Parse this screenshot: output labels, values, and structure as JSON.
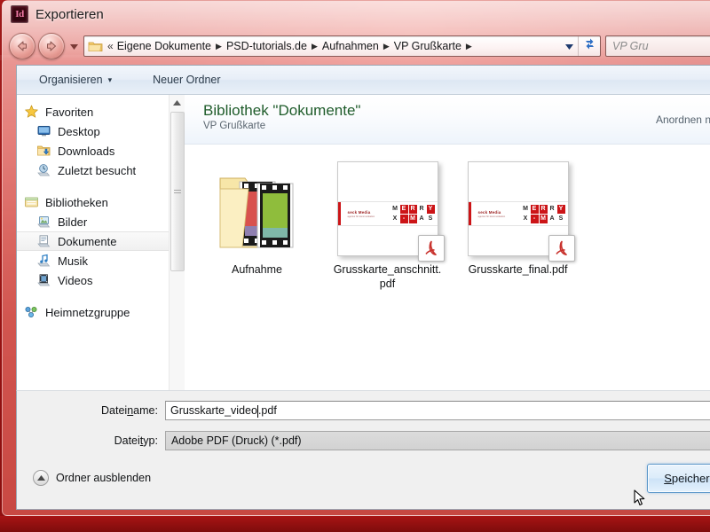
{
  "window": {
    "title": "Exportieren",
    "app_icon": "indesign-id-icon",
    "id_glyph": "Id"
  },
  "navigation": {
    "back_icon": "back-arrow-icon",
    "forward_icon": "forward-arrow-icon",
    "dropdown_icon": "chevron-down-icon",
    "refresh_icon": "refresh-icon",
    "folder_icon": "folder-icon"
  },
  "address_bar": {
    "overflow_marker": "«",
    "crumbs": [
      "Eigene Dokumente",
      "PSD-tutorials.de",
      "Aufnahmen",
      "VP Grußkarte"
    ],
    "separator": "▶"
  },
  "search": {
    "placeholder": "VP Gru",
    "icon": "search-icon"
  },
  "command_bar": {
    "organize_label": "Organisieren",
    "organize_caret": "▾",
    "new_folder_label": "Neuer Ordner"
  },
  "sidebar": {
    "groups": [
      {
        "header": {
          "label": "Favoriten",
          "icon": "star-icon"
        },
        "items": [
          {
            "label": "Desktop",
            "icon": "desktop-icon",
            "selected": false
          },
          {
            "label": "Downloads",
            "icon": "downloads-folder-icon",
            "selected": false
          },
          {
            "label": "Zuletzt besucht",
            "icon": "recent-places-icon",
            "selected": false
          }
        ]
      },
      {
        "header": {
          "label": "Bibliotheken",
          "icon": "libraries-icon"
        },
        "items": [
          {
            "label": "Bilder",
            "icon": "pictures-library-icon",
            "selected": false
          },
          {
            "label": "Dokumente",
            "icon": "documents-library-icon",
            "selected": true
          },
          {
            "label": "Musik",
            "icon": "music-library-icon",
            "selected": false
          },
          {
            "label": "Videos",
            "icon": "videos-library-icon",
            "selected": false
          }
        ]
      },
      {
        "header": {
          "label": "Heimnetzgruppe",
          "icon": "homegroup-icon"
        },
        "items": []
      }
    ],
    "scrollbar": {
      "up_arrow": "scroll-up-arrow",
      "down_arrow": "scroll-down-arrow"
    }
  },
  "content_header": {
    "title": "Bibliothek \"Dokumente\"",
    "subtitle": "VP Grußkarte",
    "arrange_label": "Anordnen n"
  },
  "files": [
    {
      "name": "Aufnahme",
      "type": "folder",
      "icon": "video-folder-icon"
    },
    {
      "name": "Grusskarte_anschnitt.pdf",
      "type": "pdf",
      "icon": "pdf-document-icon",
      "thumbnail": {
        "logo_line1": "seck Media",
        "logo_line2": "agentur für kommunikation",
        "letters_row1": [
          {
            "ch": "M",
            "style": "white"
          },
          {
            "ch": "E",
            "style": "red"
          },
          {
            "ch": "R",
            "style": "red"
          },
          {
            "ch": "R",
            "style": "white"
          },
          {
            "ch": "Y",
            "style": "red"
          }
        ],
        "letters_row2": [
          {
            "ch": "X",
            "style": "white"
          },
          {
            "ch": "-",
            "style": "red"
          },
          {
            "ch": "M",
            "style": "red"
          },
          {
            "ch": "A",
            "style": "white"
          },
          {
            "ch": "S",
            "style": "white"
          }
        ]
      }
    },
    {
      "name": "Grusskarte_final.pdf",
      "type": "pdf",
      "icon": "pdf-document-icon",
      "thumbnail": {
        "logo_line1": "seck Media",
        "logo_line2": "agentur für kommunikation",
        "letters_row1": [
          {
            "ch": "M",
            "style": "white"
          },
          {
            "ch": "E",
            "style": "red"
          },
          {
            "ch": "R",
            "style": "red"
          },
          {
            "ch": "R",
            "style": "white"
          },
          {
            "ch": "Y",
            "style": "red"
          }
        ],
        "letters_row2": [
          {
            "ch": "X",
            "style": "white"
          },
          {
            "ch": "-",
            "style": "red"
          },
          {
            "ch": "M",
            "style": "red"
          },
          {
            "ch": "A",
            "style": "white"
          },
          {
            "ch": "S",
            "style": "white"
          }
        ]
      }
    }
  ],
  "form": {
    "filename_label_pre": "Datei",
    "filename_label_accel": "n",
    "filename_label_post": "ame:",
    "filename_value_before_caret": "Grusskarte_video",
    "filename_value_after_caret": ".pdf",
    "filetype_label_pre": "Datei",
    "filetype_label_accel": "t",
    "filetype_label_post": "yp:",
    "filetype_value": "Adobe PDF (Druck) (*.pdf)",
    "hide_folders_label": "Ordner ausblenden",
    "hide_folders_icon": "chevron-up-circle-icon",
    "save_button_pre": "",
    "save_button_accel": "S",
    "save_button_post": "peichern"
  },
  "colors": {
    "app_red": "#b81b1b",
    "accent_pdf_red": "#cc1417",
    "library_title_green": "#1f5c2b",
    "selection_blue": "#5b97c9",
    "id_pink": "#f27ca8"
  },
  "cursor": {
    "icon": "mouse-pointer-icon"
  }
}
